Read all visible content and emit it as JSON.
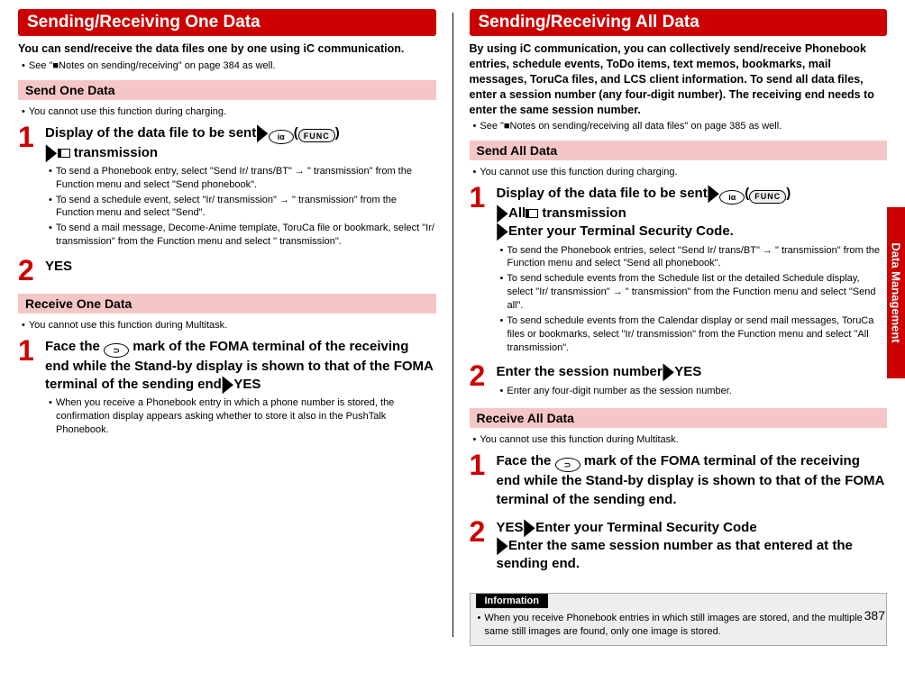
{
  "sideTab": "Data Management",
  "pageNumber": "387",
  "left": {
    "title": "Sending/Receiving One Data",
    "intro": "You can send/receive the data files one by one using iC communication.",
    "crossref": "See \"■Notes on sending/receiving\" on page 384 as well.",
    "sendHeader": "Send One Data",
    "sendNote": "You cannot use this function during charging.",
    "step1_a": "Display of the data file to be sent",
    "step1_b": " transmission",
    "step1_n1": "To send a Phonebook entry, select \"Send Ir/ trans/BT\" → \" transmission\" from the Function menu and select \"Send phonebook\".",
    "step1_n2": "To send a schedule event, select \"Ir/ transmission\" → \" transmission\" from the Function menu and select \"Send\".",
    "step1_n3": "To send a mail message, Decome-Anime template, ToruCa file or bookmark, select \"Ir/ transmission\" from the Function menu and select \" transmission\".",
    "step2": "YES",
    "recvHeader": "Receive One Data",
    "recvNote": "You cannot use this function during Multitask.",
    "recvStep1_a": "Face the ",
    "recvStep1_b": " mark of the FOMA terminal of the receiving end while the Stand-by display is shown to that of the FOMA terminal of the sending end",
    "recvStep1_c": "YES",
    "recvStep1_n": "When you receive a Phonebook entry in which a phone number is stored, the confirmation display appears asking whether to store it also in the PushTalk Phonebook."
  },
  "right": {
    "title": "Sending/Receiving All Data",
    "intro": "By using iC communication, you can collectively send/receive Phonebook entries, schedule events, ToDo items, text memos, bookmarks, mail messages, ToruCa files, and LCS client information. To send all data files, enter a session number (any four-digit number). The receiving end needs to enter the same session number.",
    "crossref": "See \"■Notes on sending/receiving all data files\" on page 385 as well.",
    "sendHeader": "Send All Data",
    "sendNote": "You cannot use this function during charging.",
    "step1_a": "Display of the data file to be sent",
    "step1_b": "All",
    "step1_c": " transmission",
    "step1_d": "Enter your Terminal Security Code.",
    "step1_n1": "To send the Phonebook entries, select \"Send Ir/ trans/BT\" → \" transmission\" from the Function menu and select \"Send all phonebook\".",
    "step1_n2": "To send schedule events from the Schedule list or the detailed Schedule display, select \"Ir/ transmission\" → \" transmission\" from the Function menu and select \"Send all\".",
    "step1_n3": "To send schedule events from the Calendar display or send mail messages, ToruCa files or bookmarks, select \"Ir/ transmission\" from the Function menu and select \"All transmission\".",
    "step2_a": "Enter the session number",
    "step2_b": "YES",
    "step2_n": "Enter any four-digit number as the session number.",
    "recvHeader": "Receive All Data",
    "recvNote": "You cannot use this function during Multitask.",
    "recvStep1_a": "Face the ",
    "recvStep1_b": " mark of the FOMA terminal of the receiving end while the Stand-by display is shown to that of the FOMA terminal of the sending end.",
    "recvStep2_a": "YES",
    "recvStep2_b": "Enter your Terminal Security Code",
    "recvStep2_c": "Enter the same session number as that entered at the sending end.",
    "infoLabel": "Information",
    "infoBody": "When you receive Phonebook entries in which still images are stored, and the multiple same still images are found, only one image is stored."
  },
  "glyphs": {
    "func": "FUNC",
    "ialpha": "iα"
  }
}
